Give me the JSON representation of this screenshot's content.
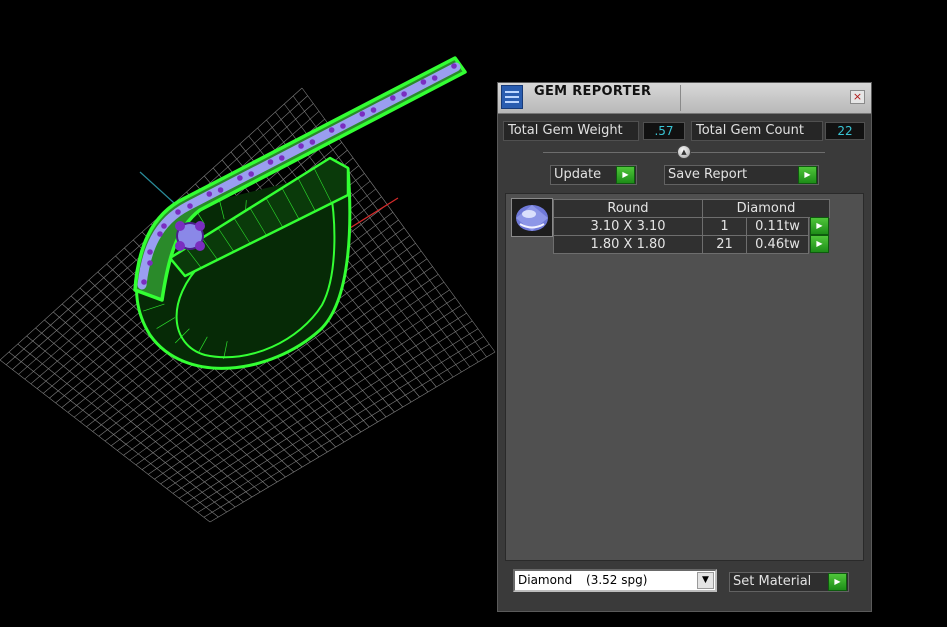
{
  "panel": {
    "title": "GEM REPORTER",
    "close_symbol": "×",
    "total_weight": {
      "label": "Total Gem Weight",
      "value": ".57"
    },
    "total_count": {
      "label": "Total Gem Count",
      "value": "22"
    },
    "update_label": "Update",
    "save_report_label": "Save Report",
    "table": {
      "headers": [
        "Round",
        "Diamond"
      ],
      "rows": [
        {
          "size": "3.10 X 3.10",
          "count": "1",
          "weight": "0.11tw"
        },
        {
          "size": "1.80 X 1.80",
          "count": "21",
          "weight": "0.46tw"
        }
      ]
    },
    "material": {
      "value": "Diamond",
      "spg": "(3.52 spg)"
    },
    "set_material_label": "Set Material"
  },
  "viewport": {
    "model_color": "#33ff33",
    "gem_color": "#9a9ef0",
    "prong_color": "#7a2ec0",
    "grid_color": "#e6e6e6"
  }
}
